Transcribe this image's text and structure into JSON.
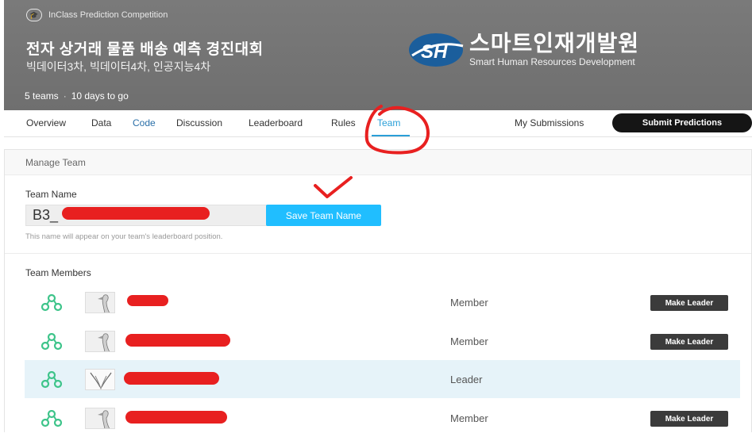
{
  "header": {
    "competition_type": "InClass Prediction Competition",
    "title": "전자 상거래 물품 배송 예측 경진대회",
    "subtitle": "빅데이터3차, 빅데이터4차, 인공지능4차",
    "teams_count": "5 teams",
    "deadline": "10 days to go",
    "logo": {
      "mark_text": "SH",
      "korean": "스마트인재개발원",
      "english": "Smart Human Resources Development"
    }
  },
  "nav": {
    "tabs": [
      {
        "label": "Overview"
      },
      {
        "label": "Data"
      },
      {
        "label": "Code"
      },
      {
        "label": "Discussion"
      },
      {
        "label": "Leaderboard"
      },
      {
        "label": "Rules"
      },
      {
        "label": "Team"
      }
    ],
    "active_tab": "Team",
    "my_submissions": "My Submissions",
    "submit_label": "Submit Predictions"
  },
  "manage_team": {
    "section_title": "Manage Team",
    "team_name_label": "Team Name",
    "team_name_value": "B3_",
    "save_label": "Save Team Name",
    "hint": "This name will appear on your team's leaderboard position.",
    "members_label": "Team Members",
    "members": [
      {
        "role": "Member",
        "action": "Make Leader"
      },
      {
        "role": "Member",
        "action": "Make Leader"
      },
      {
        "role": "Leader",
        "action": ""
      },
      {
        "role": "Member",
        "action": "Make Leader"
      }
    ]
  },
  "colors": {
    "accent": "#20beff",
    "team_icon": "#3ec48a",
    "leader_row": "#e6f3f9",
    "annotation": "#e82020",
    "banner": "#757575"
  }
}
